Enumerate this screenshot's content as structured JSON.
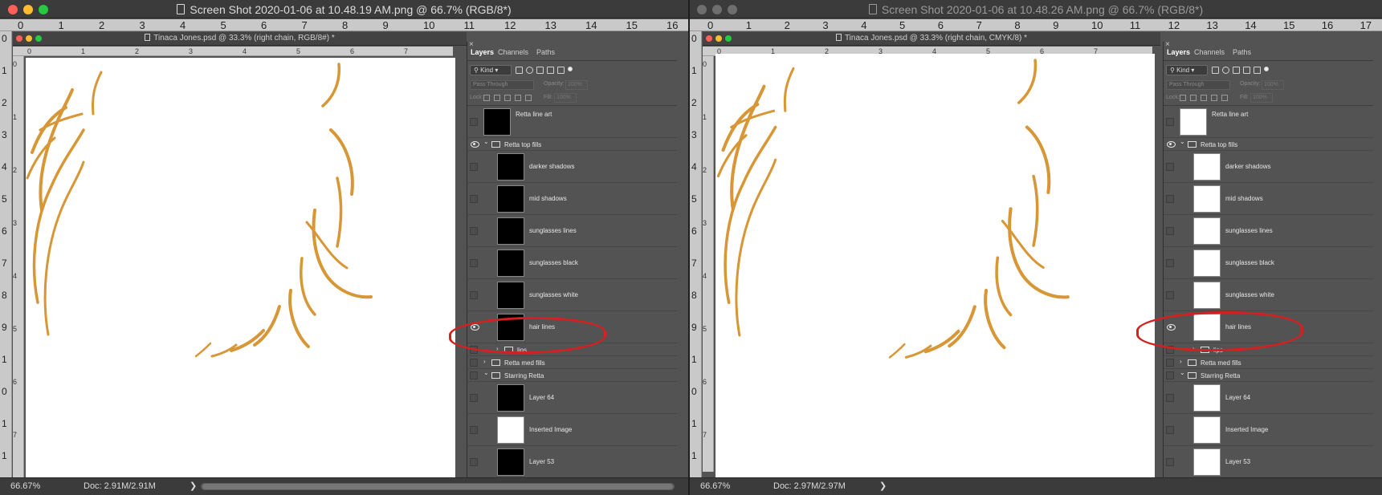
{
  "colors": {
    "hair": "#d89736",
    "annotation_red": "#d42020",
    "canvas": "#ffffff"
  },
  "left_window": {
    "title": "Screen Shot 2020-01-06 at 10.48.19 AM.png @ 66.7% (RGB/8*)",
    "doc_title": "Tinaca Jones.psd @ 33.3% (right chain, RGB/8#) *",
    "outer_ruler_labels": [
      "0",
      "1",
      "2",
      "3",
      "4",
      "5",
      "6",
      "7",
      "8",
      "9",
      "10",
      "11",
      "12",
      "13",
      "14",
      "15",
      "16"
    ],
    "outer_vruler_labels": [
      "0",
      "1",
      "2",
      "3",
      "4",
      "5",
      "6",
      "7",
      "8",
      "9",
      "1",
      "0",
      "1",
      "1"
    ],
    "inner_ruler_labels": [
      "0",
      "1",
      "2",
      "3",
      "4",
      "5",
      "6",
      "7"
    ],
    "inner_vruler_labels": [
      "0",
      "1",
      "2",
      "3",
      "4",
      "5",
      "6",
      "7"
    ],
    "zoom": "66.67%",
    "doc_size": "Doc: 2.91M/2.91M",
    "arrow": "❯",
    "panel": {
      "tabs": [
        "Layers",
        "Channels",
        "Paths"
      ],
      "kind": "Kind",
      "blend": "Pass Through",
      "opacity_label": "Opacity:",
      "opacity_value": "100%",
      "lock_label": "Lock:",
      "fill_label": "Fill:",
      "fill_value": "100%",
      "close": "×",
      "layers": [
        {
          "name": "Retta line art",
          "type": "layer",
          "visible": false,
          "thumb": "black"
        },
        {
          "name": "Retta top fills",
          "type": "group-open",
          "visible": true
        },
        {
          "name": "darker shadows",
          "type": "layer",
          "visible": false,
          "thumb": "black"
        },
        {
          "name": "mid shadows",
          "type": "layer",
          "visible": false,
          "thumb": "black"
        },
        {
          "name": "sunglasses lines",
          "type": "layer",
          "visible": false,
          "thumb": "black"
        },
        {
          "name": "sunglasses black",
          "type": "layer",
          "visible": false,
          "thumb": "black"
        },
        {
          "name": "sunglasses white",
          "type": "layer",
          "visible": false,
          "thumb": "black"
        },
        {
          "name": "hair lines",
          "type": "layer",
          "visible": true,
          "thumb": "black"
        },
        {
          "name": "lips",
          "type": "group-closed",
          "visible": false
        },
        {
          "name": "Retta med fills",
          "type": "group-closed",
          "visible": false
        },
        {
          "name": "Starring Retta",
          "type": "group-open",
          "visible": false
        },
        {
          "name": "Layer 64",
          "type": "layer",
          "visible": false,
          "thumb": "black"
        },
        {
          "name": "Inserted Image",
          "type": "layer",
          "visible": false,
          "thumb": "white"
        },
        {
          "name": "Layer 53",
          "type": "layer",
          "visible": false,
          "thumb": "black"
        }
      ]
    }
  },
  "right_window": {
    "title": "Screen Shot 2020-01-06 at 10.48.26 AM.png @ 66.7% (RGB/8*)",
    "doc_title": "Tinaca Jones.psd @ 33.3% (right chain, CMYK/8) *",
    "outer_ruler_labels": [
      "0",
      "1",
      "2",
      "3",
      "4",
      "5",
      "6",
      "7",
      "8",
      "9",
      "10",
      "11",
      "12",
      "13",
      "14",
      "15",
      "16",
      "17"
    ],
    "outer_vruler_labels": [
      "0",
      "1",
      "2",
      "3",
      "4",
      "5",
      "6",
      "7",
      "8",
      "9",
      "1",
      "0",
      "1",
      "1"
    ],
    "inner_ruler_labels": [
      "0",
      "1",
      "2",
      "3",
      "4",
      "5",
      "6",
      "7"
    ],
    "inner_vruler_labels": [
      "0",
      "1",
      "2",
      "3",
      "4",
      "5",
      "6",
      "7"
    ],
    "zoom": "66.67%",
    "doc_size": "Doc: 2.97M/2.97M",
    "arrow": "❯",
    "panel": {
      "tabs": [
        "Layers",
        "Channels",
        "Paths"
      ],
      "kind": "Kind",
      "blend": "Pass Through",
      "opacity_label": "Opacity:",
      "opacity_value": "100%",
      "lock_label": "Lock:",
      "fill_label": "Fill:",
      "fill_value": "100%",
      "close": "×",
      "layers": [
        {
          "name": "Retta line art",
          "type": "layer",
          "visible": false,
          "thumb": "white"
        },
        {
          "name": "Retta top fills",
          "type": "group-open",
          "visible": true
        },
        {
          "name": "darker shadows",
          "type": "layer",
          "visible": false,
          "thumb": "white"
        },
        {
          "name": "mid shadows",
          "type": "layer",
          "visible": false,
          "thumb": "white"
        },
        {
          "name": "sunglasses lines",
          "type": "layer",
          "visible": false,
          "thumb": "white"
        },
        {
          "name": "sunglasses black",
          "type": "layer",
          "visible": false,
          "thumb": "white"
        },
        {
          "name": "sunglasses white",
          "type": "layer",
          "visible": false,
          "thumb": "white"
        },
        {
          "name": "hair lines",
          "type": "layer",
          "visible": true,
          "thumb": "white"
        },
        {
          "name": "lips",
          "type": "group-closed",
          "visible": false
        },
        {
          "name": "Retta med fills",
          "type": "group-closed",
          "visible": false
        },
        {
          "name": "Starring Retta",
          "type": "group-open",
          "visible": false
        },
        {
          "name": "Layer 64",
          "type": "layer",
          "visible": false,
          "thumb": "white"
        },
        {
          "name": "Inserted Image",
          "type": "layer",
          "visible": false,
          "thumb": "white"
        },
        {
          "name": "Layer 53",
          "type": "layer",
          "visible": false,
          "thumb": "white"
        }
      ]
    }
  }
}
